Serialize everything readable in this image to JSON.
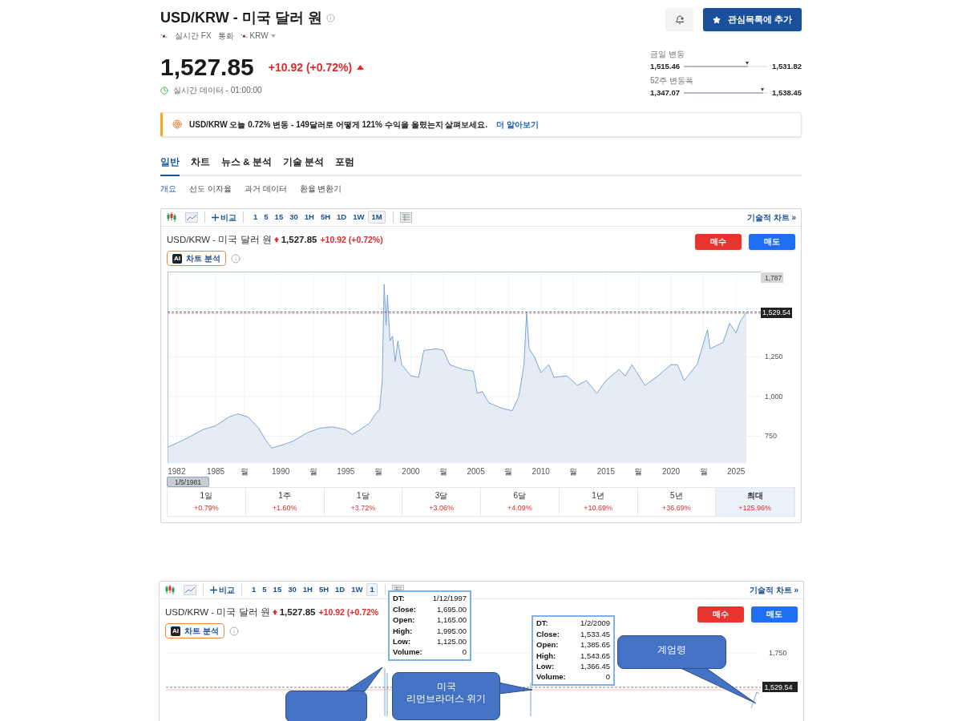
{
  "instrument": {
    "title": "USD/KRW - 미국 달러 원",
    "market": "실시간 FX",
    "type": "통화",
    "currency": "KRW"
  },
  "actions": {
    "watchlist_button": "관심목록에 추가"
  },
  "quote": {
    "price": "1,527.85",
    "change": "+10.92 (+0.72%)",
    "status": "실시간 데이터 - 01:00:00"
  },
  "ranges": [
    {
      "label": "금일 변동",
      "low": "1,515.46",
      "high": "1,531.82",
      "level": 0.76
    },
    {
      "label": "52주 변동폭",
      "low": "1,347.07",
      "high": "1,538.45",
      "level": 0.94
    }
  ],
  "banner": {
    "text": "USD/KRW 오늘 0.72% 변동 - 149달러로 어떻게 121% 수익을 올렸는지 살펴보세요.",
    "link": "더 알아보기"
  },
  "tabs": [
    {
      "label": "일반",
      "selected": true
    },
    {
      "label": "차트",
      "selected": false
    },
    {
      "label": "뉴스 & 분석",
      "selected": false
    },
    {
      "label": "기술 분석",
      "selected": false
    },
    {
      "label": "포럼",
      "selected": false
    }
  ],
  "subtabs": [
    {
      "label": "개요",
      "selected": true
    },
    {
      "label": "선도 이자율",
      "selected": false
    },
    {
      "label": "과거 데이터",
      "selected": false
    },
    {
      "label": "환율 변환기",
      "selected": false
    }
  ],
  "main_chart": {
    "toolbar": {
      "compare": "비교",
      "intervals": [
        {
          "label": "1",
          "selected": false
        },
        {
          "label": "5",
          "selected": false
        },
        {
          "label": "15",
          "selected": false
        },
        {
          "label": "30",
          "selected": false
        },
        {
          "label": "1H",
          "selected": false
        },
        {
          "label": "5H",
          "selected": false
        },
        {
          "label": "1D",
          "selected": false
        },
        {
          "label": "1W",
          "selected": false
        },
        {
          "label": "1M",
          "selected": true
        }
      ],
      "advanced_link": "기술적 차트 »"
    },
    "legend": {
      "name": "USD/KRW - 미국 달러 원",
      "price": "1,527.85",
      "change": "+10.92 (+0.72%)",
      "ai_badge": "AI",
      "ai_button": "차트 분석",
      "buy": "매수",
      "sell": "매도"
    },
    "chart_data": {
      "type": "area",
      "x": [
        1981.3,
        1982,
        1983,
        1984,
        1985,
        1986,
        1986.7,
        1987.5,
        1988.3,
        1988.8,
        1989.3,
        1990,
        1991,
        1992,
        1993,
        1994,
        1995,
        1995.5,
        1996,
        1996.8,
        1997.3,
        1997.6,
        1997.8,
        1997.95,
        1998.1,
        1998.2,
        1998.4,
        1998.6,
        1998.8,
        1999,
        1999.3,
        2000,
        2000.6,
        2001,
        2002,
        2002.5,
        2003,
        2004,
        2004.8,
        2005.1,
        2005.5,
        2006,
        2007,
        2007.8,
        2008.3,
        2008.7,
        2008.9,
        2009.1,
        2009.5,
        2010,
        2010.6,
        2011,
        2012,
        2012.8,
        2013.5,
        2014.3,
        2015,
        2016,
        2016.5,
        2017,
        2018,
        2019,
        2020,
        2020.5,
        2021,
        2022,
        2022.8,
        2023,
        2024,
        2024.5,
        2025,
        2025.3,
        2025.8
      ],
      "series": [
        {
          "color": "#7ba7d4",
          "values": [
            680,
            705,
            745,
            790,
            815,
            870,
            890,
            870,
            800,
            730,
            675,
            690,
            720,
            770,
            800,
            808,
            790,
            760,
            785,
            830,
            890,
            920,
            1100,
            1707,
            1450,
            1640,
            1350,
            1380,
            1220,
            1350,
            1200,
            1130,
            1120,
            1290,
            1300,
            1290,
            1200,
            1170,
            1160,
            1020,
            1030,
            960,
            925,
            910,
            1000,
            1200,
            1530,
            1300,
            1250,
            1150,
            1200,
            1120,
            1130,
            1070,
            1100,
            1020,
            1100,
            1170,
            1130,
            1200,
            1070,
            1130,
            1200,
            1200,
            1100,
            1200,
            1420,
            1300,
            1340,
            1460,
            1400,
            1470,
            1530
          ]
        }
      ],
      "xlim": [
        1981.3,
        2026.9
      ],
      "ylim": [
        580,
        1787
      ],
      "xticks": [
        {
          "value": 1982,
          "label": "1982"
        },
        {
          "value": 1985,
          "label": "1985"
        },
        {
          "value": 1987.2,
          "label": "월"
        },
        {
          "value": 1990,
          "label": "1990"
        },
        {
          "value": 1992.5,
          "label": "월"
        },
        {
          "value": 1995,
          "label": "1995"
        },
        {
          "value": 1997.5,
          "label": "월"
        },
        {
          "value": 2000,
          "label": "2000"
        },
        {
          "value": 2002.5,
          "label": "월"
        },
        {
          "value": 2005,
          "label": "2005"
        },
        {
          "value": 2007.5,
          "label": "월"
        },
        {
          "value": 2010,
          "label": "2010"
        },
        {
          "value": 2012.5,
          "label": "월"
        },
        {
          "value": 2015,
          "label": "2015"
        },
        {
          "value": 2017.5,
          "label": "월"
        },
        {
          "value": 2020,
          "label": "2020"
        },
        {
          "value": 2022.5,
          "label": "월"
        },
        {
          "value": 2025,
          "label": "2025"
        }
      ],
      "yticks": [
        {
          "value": 750,
          "label": "750"
        },
        {
          "value": 1000,
          "label": "1,000"
        },
        {
          "value": 1250,
          "label": "1,250"
        },
        {
          "value": 1787,
          "label": "1,787"
        }
      ],
      "grid": true
    },
    "price_tag": "1,529.54",
    "crosshair_date": "1/5/1981",
    "periods": [
      {
        "label": "1일",
        "change": "+0.79%",
        "selected": false
      },
      {
        "label": "1주",
        "change": "+1.60%",
        "selected": false
      },
      {
        "label": "1달",
        "change": "+3.72%",
        "selected": false
      },
      {
        "label": "3달",
        "change": "+3.06%",
        "selected": false
      },
      {
        "label": "6달",
        "change": "+4.09%",
        "selected": false
      },
      {
        "label": "1년",
        "change": "+10.69%",
        "selected": false
      },
      {
        "label": "5년",
        "change": "+36.69%",
        "selected": false
      },
      {
        "label": "최대",
        "change": "+125.96%",
        "selected": true
      }
    ]
  },
  "annotated_chart": {
    "toolbar": {
      "compare": "비교",
      "intervals": [
        {
          "label": "1",
          "selected": false
        },
        {
          "label": "5",
          "selected": false
        },
        {
          "label": "15",
          "selected": false
        },
        {
          "label": "30",
          "selected": false
        },
        {
          "label": "1H",
          "selected": false
        },
        {
          "label": "5H",
          "selected": false
        },
        {
          "label": "1D",
          "selected": false
        },
        {
          "label": "1W",
          "selected": false
        },
        {
          "label": "1",
          "selected": true
        }
      ],
      "advanced_link": "기술적 차트 »"
    },
    "legend": {
      "name": "USD/KRW - 미국 달러 원",
      "price": "1,527.85",
      "change": "+10.92 (+0.72%",
      "ai_badge": "AI",
      "ai_button": "차트 분석",
      "buy": "매수",
      "sell": "매도"
    },
    "axis_label": "1,750",
    "price_label": "1,529.54",
    "tooltips": [
      {
        "rows": [
          {
            "label": "DT:",
            "value": "1/12/1997"
          },
          {
            "label": "Close:",
            "value": "1,695.00"
          },
          {
            "label": "Open:",
            "value": "1,165.00"
          },
          {
            "label": "High:",
            "value": "1,995.00"
          },
          {
            "label": "Low:",
            "value": "1,125.00"
          },
          {
            "label": "Volume:",
            "value": "0"
          }
        ]
      },
      {
        "rows": [
          {
            "label": "DT:",
            "value": "1/2/2009"
          },
          {
            "label": "Close:",
            "value": "1,533.45"
          },
          {
            "label": "Open:",
            "value": "1,385.65"
          },
          {
            "label": "High:",
            "value": "1,543.65"
          },
          {
            "label": "Low:",
            "value": "1,366.45"
          },
          {
            "label": "Volume:",
            "value": "0"
          }
        ]
      }
    ],
    "callouts": [
      {
        "kind": "text",
        "lines": [
          "계엄령"
        ]
      },
      {
        "kind": "text",
        "lines": [
          "미국",
          "리먼브라더스 위기"
        ]
      },
      {
        "kind": "blank"
      }
    ]
  }
}
